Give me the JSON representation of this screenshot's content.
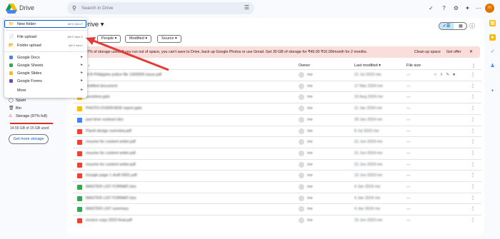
{
  "app": {
    "title": "Drive"
  },
  "search": {
    "placeholder": "Search in Drive"
  },
  "user": {
    "initial": "m"
  },
  "main": {
    "heading": "Drive ▾"
  },
  "filters": {
    "people": "People ▾",
    "modified": "Modified ▾",
    "source": "Source ▾"
  },
  "banner": {
    "text": "7% of storage used. If you run out of space, you can't save to Drive, back up Google Photos or use Gmail. Get 30 GB of storage for ₹49.00 ₹10.00/month for 2 months.",
    "cleanup": "Clean up space",
    "offer": "Get offer",
    "close": "✕"
  },
  "table_headers": {
    "owner": "Owner",
    "modified": "Last modified ▾",
    "size": "File size"
  },
  "new_menu": {
    "new_folder": "New folder",
    "new_folder_shortcut": "Alt+C then F",
    "file_upload": "File upload",
    "file_upload_shortcut": "Alt+C then U",
    "folder_upload": "Folder upload",
    "folder_upload_shortcut": "Alt+C then I",
    "docs": "Google Docs",
    "sheets": "Google Sheets",
    "slides": "Google Slides",
    "forms": "Google Forms",
    "more": "More"
  },
  "sidebar": {
    "spam": "Spam",
    "bin": "Bin",
    "storage": "Storage (97% full)",
    "storage_used": "14.55 GB of 15 GB used",
    "storage_fraction": 0.97,
    "get_more": "Get more storage"
  },
  "files": [
    {
      "name": "M B Philippine police file 1000000 issue.pdf",
      "owner": "me",
      "modified": "21 Jul 2023 me",
      "size": "—",
      "type": "pdf"
    },
    {
      "name": "Untitled document",
      "owner": "me",
      "modified": "17 Mar 2024 me",
      "size": "—",
      "type": "doc"
    },
    {
      "name": "sunshine.pptx",
      "owner": "me",
      "modified": "15 Aug 2024 me",
      "size": "—",
      "type": "slides"
    },
    {
      "name": "PHOTO-OVERVIEW report.pptx",
      "owner": "me",
      "modified": "11 Jan 2024 me",
      "size": "—",
      "type": "slides"
    },
    {
      "name": "part time contract doc",
      "owner": "me",
      "modified": "29 Jan 2024 me",
      "size": "—",
      "type": "doc"
    },
    {
      "name": "PlanIt design overview.pdf",
      "owner": "me",
      "modified": "8 Jul 2023 me",
      "size": "—",
      "type": "pdf"
    },
    {
      "name": "resume for content writer.pdf",
      "owner": "me",
      "modified": "21 Jun 2024 me",
      "size": "—",
      "type": "pdf"
    },
    {
      "name": "resume for content writer.pdf",
      "owner": "me",
      "modified": "21 Jun 2024 me",
      "size": "—",
      "type": "pdf"
    },
    {
      "name": "resume for content writer.pdf",
      "owner": "me",
      "modified": "21 Jun 2024 me",
      "size": "—",
      "type": "pdf"
    },
    {
      "name": "Google page 1 draft 0001.pdf",
      "owner": "me",
      "modified": "12 Jun 2023 me",
      "size": "—",
      "type": "pdf"
    },
    {
      "name": "MASTER LIST FORMAT.xlsx",
      "owner": "me",
      "modified": "4 Jan 2024 me",
      "size": "—",
      "type": "sheet"
    },
    {
      "name": "MASTER LIST FORMAT.xlsx",
      "owner": "me",
      "modified": "4 Jan 2024 me",
      "size": "—",
      "type": "sheet"
    },
    {
      "name": "MASTER LIST summary",
      "owner": "me",
      "modified": "4 Jan 2024 me",
      "size": "—",
      "type": "sheet"
    },
    {
      "name": "invoice copy 2023 final.pdf",
      "owner": "me",
      "modified": "15 Jun 2023 me",
      "size": "—",
      "type": "pdf"
    }
  ],
  "colors": {
    "pdf": "#ea4335",
    "doc": "#4285f4",
    "slides": "#fbbc04",
    "sheet": "#34a853",
    "accent": "#0b57d0",
    "arrow": "#e53935"
  }
}
